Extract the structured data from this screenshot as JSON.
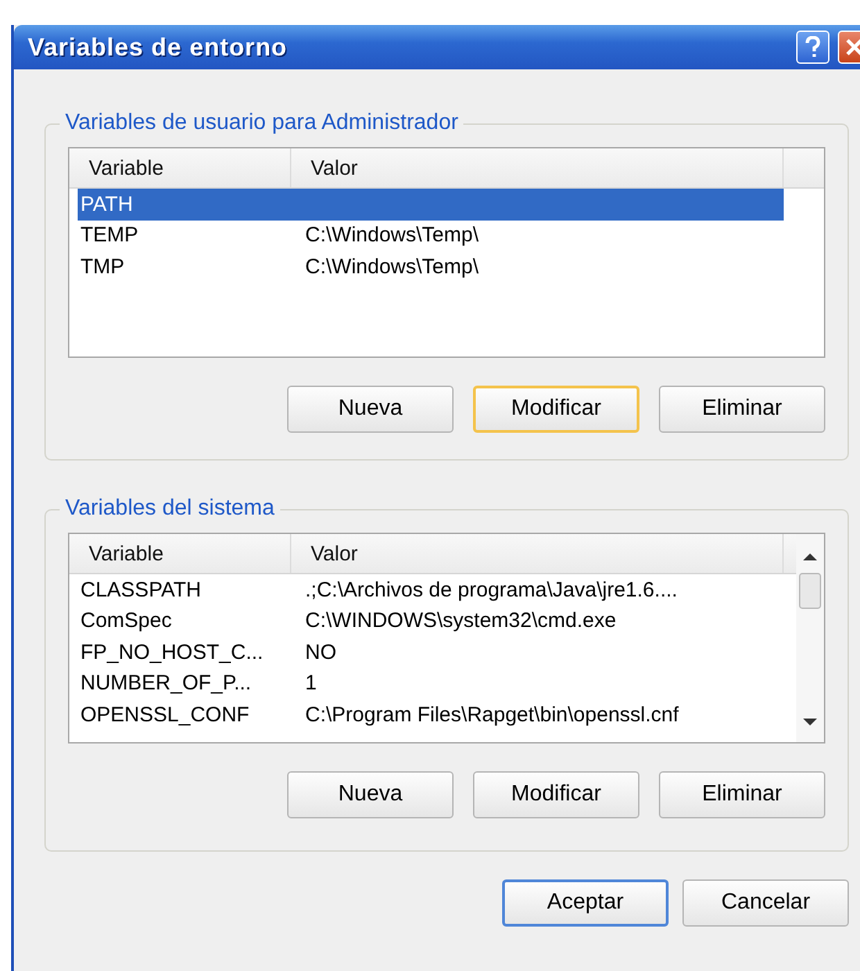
{
  "window": {
    "title": "Variables de entorno"
  },
  "user_group": {
    "title": "Variables de usuario para Administrador",
    "columns": [
      "Variable",
      "Valor"
    ],
    "rows": [
      {
        "variable": "PATH",
        "value": "",
        "selected": true
      },
      {
        "variable": "TEMP",
        "value": "C:\\Windows\\Temp\\",
        "selected": false
      },
      {
        "variable": "TMP",
        "value": "C:\\Windows\\Temp\\",
        "selected": false
      }
    ],
    "buttons": [
      {
        "label": "Nueva",
        "kind": "normal"
      },
      {
        "label": "Modificar",
        "kind": "hot"
      },
      {
        "label": "Eliminar",
        "kind": "normal"
      }
    ]
  },
  "system_group": {
    "title": "Variables del sistema",
    "columns": [
      "Variable",
      "Valor"
    ],
    "rows": [
      {
        "variable": "CLASSPATH",
        "value": ".;C:\\Archivos de programa\\Java\\jre1.6....",
        "selected": false
      },
      {
        "variable": "ComSpec",
        "value": "C:\\WINDOWS\\system32\\cmd.exe",
        "selected": false
      },
      {
        "variable": "FP_NO_HOST_C...",
        "value": "NO",
        "selected": false
      },
      {
        "variable": "NUMBER_OF_P...",
        "value": "1",
        "selected": false
      },
      {
        "variable": "OPENSSL_CONF",
        "value": "C:\\Program Files\\Rapget\\bin\\openssl.cnf",
        "selected": false
      }
    ],
    "scrollbar": true,
    "buttons": [
      {
        "label": "Nueva",
        "kind": "normal"
      },
      {
        "label": "Modificar",
        "kind": "normal"
      },
      {
        "label": "Eliminar",
        "kind": "normal"
      }
    ]
  },
  "dialog_buttons": [
    {
      "label": "Aceptar",
      "kind": "default"
    },
    {
      "label": "Cancelar",
      "kind": "normal"
    }
  ]
}
